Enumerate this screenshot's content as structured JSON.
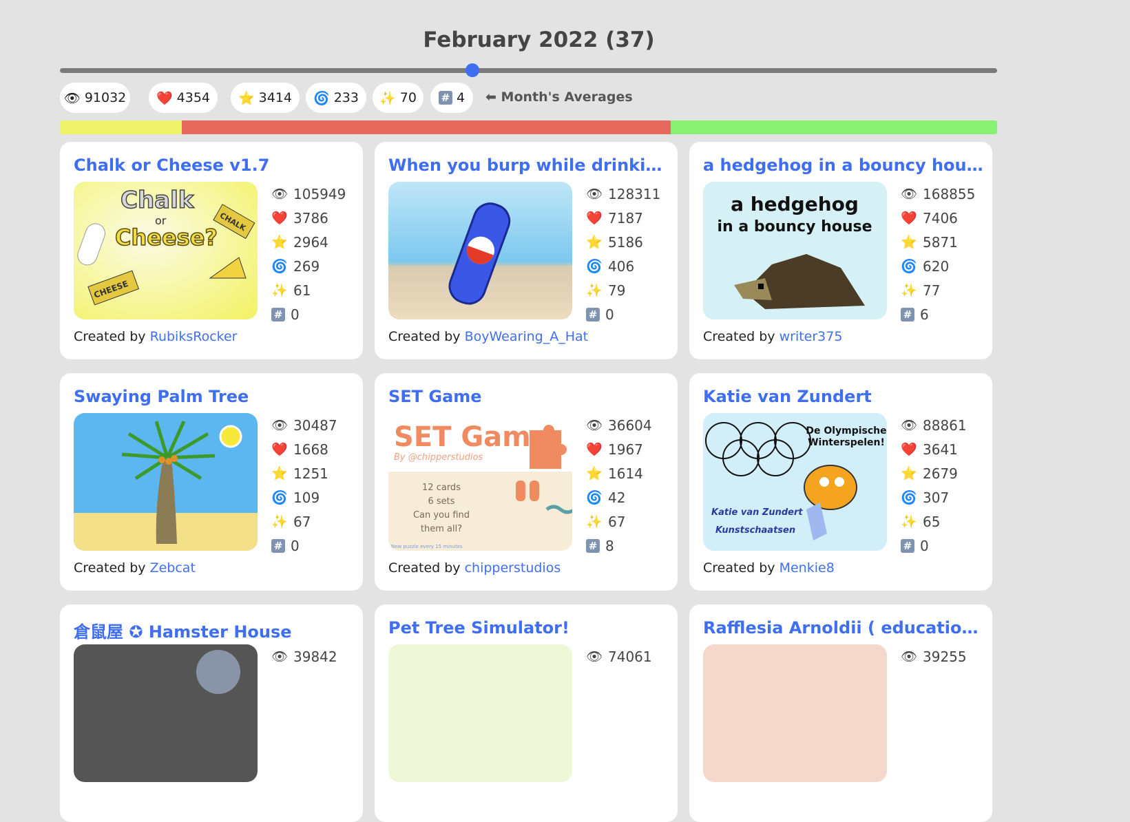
{
  "month": {
    "title": "February 2022 (37)",
    "slider_position": 0.44
  },
  "averages": {
    "views": "91032",
    "loves": "4354",
    "favorites": "3414",
    "remixes": "233",
    "trending": "70",
    "rank": "4",
    "label": "⬅ Month's Averages"
  },
  "icons": {
    "views": "👁",
    "loves": "❤️",
    "favorites": "⭐",
    "remixes": "🌀",
    "trending": "✨",
    "rank": "#"
  },
  "ratio_bar": [
    {
      "color": "#eef36a",
      "fraction": 0.13
    },
    {
      "color": "#e7685c",
      "fraction": 0.522
    },
    {
      "color": "#88f072",
      "fraction": 0.348
    }
  ],
  "created_by_label": "Created by",
  "projects": [
    {
      "title": "Chalk or Cheese v1.7",
      "views": "105949",
      "loves": "3786",
      "favorites": "2964",
      "remixes": "269",
      "trending": "61",
      "rank": "0",
      "creator": "RubiksRocker",
      "thumb_text": [
        "Chalk",
        "or",
        "Cheese?",
        "CHALK",
        "CHEESE"
      ]
    },
    {
      "title": "When you burp while drinking s...",
      "views": "128311",
      "loves": "7187",
      "favorites": "5186",
      "remixes": "406",
      "trending": "79",
      "rank": "0",
      "creator": "BoyWearing_A_Hat",
      "thumb_text": []
    },
    {
      "title": "a hedgehog in a bouncy house",
      "views": "168855",
      "loves": "7406",
      "favorites": "5871",
      "remixes": "620",
      "trending": "77",
      "rank": "6",
      "creator": "writer375",
      "thumb_text": [
        "a hedgehog",
        "in a bouncy house"
      ]
    },
    {
      "title": "Swaying Palm Tree",
      "views": "30487",
      "loves": "1668",
      "favorites": "1251",
      "remixes": "109",
      "trending": "67",
      "rank": "0",
      "creator": "Zebcat",
      "thumb_text": []
    },
    {
      "title": "SET Game",
      "views": "36604",
      "loves": "1967",
      "favorites": "1614",
      "remixes": "42",
      "trending": "67",
      "rank": "8",
      "creator": "chipperstudios",
      "thumb_text": [
        "SET Game",
        "By @chipperstudios",
        "12 cards",
        "6 sets",
        "Can you find",
        "them all?",
        "New puzzle every 15 minutes"
      ]
    },
    {
      "title": "Katie van Zundert",
      "views": "88861",
      "loves": "3641",
      "favorites": "2679",
      "remixes": "307",
      "trending": "65",
      "rank": "0",
      "creator": "Menkie8",
      "thumb_text": [
        "De Olympische",
        "Winterspelen!",
        "Katie van Zundert",
        "Kunstschaatsen"
      ]
    },
    {
      "title": "倉鼠屋 ✪ Hamster House",
      "views": "39842",
      "loves": "",
      "favorites": "",
      "remixes": "",
      "trending": "",
      "rank": "",
      "creator": "",
      "thumb_text": []
    },
    {
      "title": "Pet Tree Simulator!",
      "views": "74061",
      "loves": "",
      "favorites": "",
      "remixes": "",
      "trending": "",
      "rank": "",
      "creator": "",
      "thumb_text": []
    },
    {
      "title": "Rafflesia Arnoldii ( educational f...",
      "views": "39255",
      "loves": "",
      "favorites": "",
      "remixes": "",
      "trending": "",
      "rank": "",
      "creator": "",
      "thumb_text": []
    }
  ]
}
